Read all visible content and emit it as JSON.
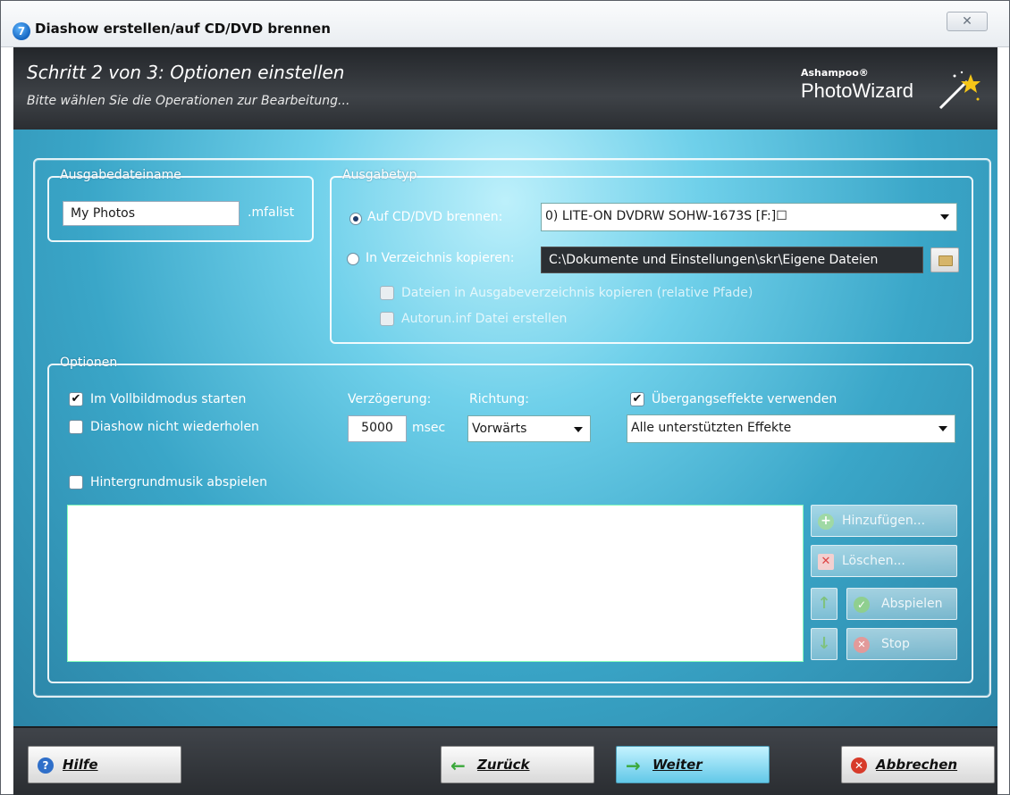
{
  "window": {
    "title": "Diashow erstellen/auf CD/DVD brennen",
    "app_icon_glyph": "7",
    "close_glyph": "✕"
  },
  "header": {
    "step_title": "Schritt 2 von 3: Optionen einstellen",
    "step_subtitle": "Bitte wählen Sie die Operationen zur Bearbeitung...",
    "logo_brand": "Ashampoo®",
    "logo_name": "PhotoWizard"
  },
  "output_file": {
    "legend": "Ausgabedateiname",
    "value": "My Photos",
    "extension": ".mfalist"
  },
  "output_type": {
    "legend": "Ausgabetyp",
    "burn_label": "Auf CD/DVD brennen:",
    "burn_selected": true,
    "drive_value": "0) LITE-ON DVDRW SOHW-1673S [F:]☐",
    "copy_label": "In Verzeichnis kopieren:",
    "copy_selected": false,
    "path_value": "C:\\Dokumente und Einstellungen\\skr\\Eigene Dateien",
    "copy_files_label": "Dateien in Ausgabeverzeichnis kopieren (relative Pfade)",
    "autorun_label": "Autorun.inf Datei erstellen"
  },
  "options": {
    "legend": "Optionen",
    "fullscreen_label": "Im Vollbildmodus starten",
    "fullscreen_checked": true,
    "no_repeat_label": "Diashow nicht wiederholen",
    "no_repeat_checked": false,
    "delay_label": "Verzögerung:",
    "delay_value": "5000",
    "delay_unit": "msec",
    "direction_label": "Richtung:",
    "direction_value": "Vorwärts",
    "transitions_label": "Übergangseffekte verwenden",
    "transitions_checked": true,
    "effects_value": "Alle unterstützten Effekte",
    "music_label": "Hintergrundmusik abspielen",
    "music_checked": false,
    "check_glyph": "✔",
    "buttons": {
      "add": "Hinzufügen...",
      "delete": "Löschen...",
      "play": "Abspielen",
      "stop": "Stop",
      "up_glyph": "↑",
      "down_glyph": "↓"
    }
  },
  "footer": {
    "help": "Hilfe",
    "back": "Zurück",
    "next": "Weiter",
    "cancel": "Abbrechen"
  },
  "colors": {
    "accent": "#62c8e8",
    "header_bg": "#2f3236",
    "content_bg": "#3aa6c8"
  }
}
